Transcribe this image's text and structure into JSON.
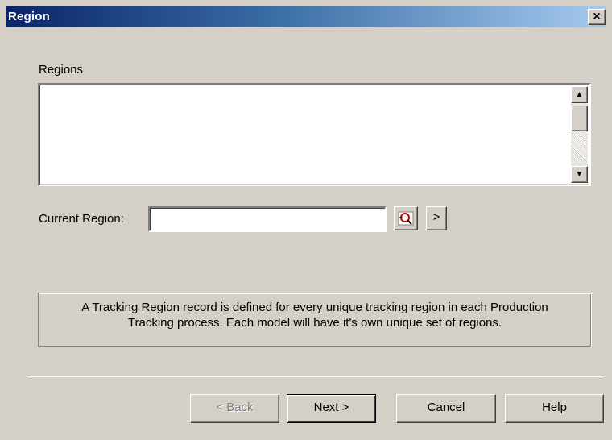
{
  "window": {
    "title": "Region",
    "close_glyph": "×"
  },
  "regions": {
    "label": "Regions",
    "items": []
  },
  "current_region": {
    "label": "Current Region:",
    "value": "",
    "search_icon": "search-region-icon",
    "next_glyph": ">"
  },
  "info": {
    "line1": "A Tracking Region record is defined for every unique tracking region in each Production",
    "line2": "Tracking process.  Each model will have it's own unique set of regions."
  },
  "buttons": {
    "back": "< Back",
    "next": "Next >",
    "cancel": "Cancel",
    "help": "Help"
  },
  "colors": {
    "face": "#d4d0c8",
    "title_start": "#0a246a",
    "title_end": "#a6caf0",
    "disabled_text": "#808080"
  }
}
